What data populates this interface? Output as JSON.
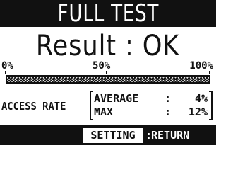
{
  "header": {
    "title": "FULL TEST"
  },
  "result": {
    "text": "Result : OK"
  },
  "progress": {
    "scale_start": "0%",
    "scale_mid": "50%",
    "scale_end": "100%",
    "value_percent": 100
  },
  "access_rate": {
    "label": "ACCESS RATE",
    "average": {
      "name": "AVERAGE",
      "separator": ":",
      "value": "4%"
    },
    "max": {
      "name": "MAX",
      "separator": ":",
      "value": "12%"
    }
  },
  "footer": {
    "setting_label": "SETTING",
    "separator": ":",
    "return_label": "RETURN"
  },
  "colors": {
    "background": "#ffffff",
    "foreground": "#111111",
    "inverse_text": "#ffffff"
  }
}
